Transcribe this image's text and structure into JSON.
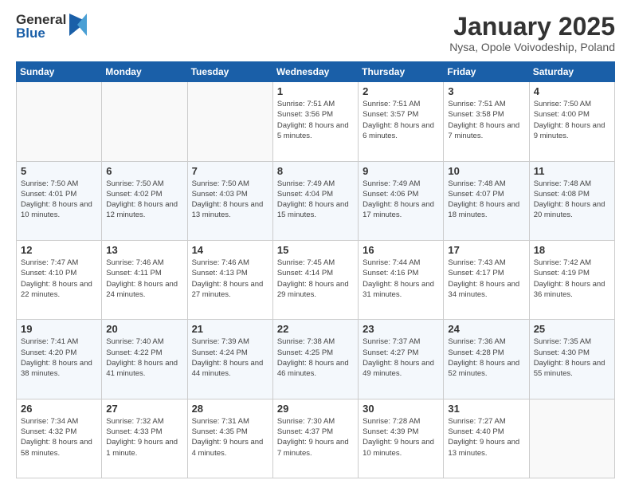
{
  "logo": {
    "general": "General",
    "blue": "Blue"
  },
  "title": "January 2025",
  "subtitle": "Nysa, Opole Voivodeship, Poland",
  "weekdays": [
    "Sunday",
    "Monday",
    "Tuesday",
    "Wednesday",
    "Thursday",
    "Friday",
    "Saturday"
  ],
  "weeks": [
    [
      {
        "day": "",
        "info": ""
      },
      {
        "day": "",
        "info": ""
      },
      {
        "day": "",
        "info": ""
      },
      {
        "day": "1",
        "info": "Sunrise: 7:51 AM\nSunset: 3:56 PM\nDaylight: 8 hours and 5 minutes."
      },
      {
        "day": "2",
        "info": "Sunrise: 7:51 AM\nSunset: 3:57 PM\nDaylight: 8 hours and 6 minutes."
      },
      {
        "day": "3",
        "info": "Sunrise: 7:51 AM\nSunset: 3:58 PM\nDaylight: 8 hours and 7 minutes."
      },
      {
        "day": "4",
        "info": "Sunrise: 7:50 AM\nSunset: 4:00 PM\nDaylight: 8 hours and 9 minutes."
      }
    ],
    [
      {
        "day": "5",
        "info": "Sunrise: 7:50 AM\nSunset: 4:01 PM\nDaylight: 8 hours and 10 minutes."
      },
      {
        "day": "6",
        "info": "Sunrise: 7:50 AM\nSunset: 4:02 PM\nDaylight: 8 hours and 12 minutes."
      },
      {
        "day": "7",
        "info": "Sunrise: 7:50 AM\nSunset: 4:03 PM\nDaylight: 8 hours and 13 minutes."
      },
      {
        "day": "8",
        "info": "Sunrise: 7:49 AM\nSunset: 4:04 PM\nDaylight: 8 hours and 15 minutes."
      },
      {
        "day": "9",
        "info": "Sunrise: 7:49 AM\nSunset: 4:06 PM\nDaylight: 8 hours and 17 minutes."
      },
      {
        "day": "10",
        "info": "Sunrise: 7:48 AM\nSunset: 4:07 PM\nDaylight: 8 hours and 18 minutes."
      },
      {
        "day": "11",
        "info": "Sunrise: 7:48 AM\nSunset: 4:08 PM\nDaylight: 8 hours and 20 minutes."
      }
    ],
    [
      {
        "day": "12",
        "info": "Sunrise: 7:47 AM\nSunset: 4:10 PM\nDaylight: 8 hours and 22 minutes."
      },
      {
        "day": "13",
        "info": "Sunrise: 7:46 AM\nSunset: 4:11 PM\nDaylight: 8 hours and 24 minutes."
      },
      {
        "day": "14",
        "info": "Sunrise: 7:46 AM\nSunset: 4:13 PM\nDaylight: 8 hours and 27 minutes."
      },
      {
        "day": "15",
        "info": "Sunrise: 7:45 AM\nSunset: 4:14 PM\nDaylight: 8 hours and 29 minutes."
      },
      {
        "day": "16",
        "info": "Sunrise: 7:44 AM\nSunset: 4:16 PM\nDaylight: 8 hours and 31 minutes."
      },
      {
        "day": "17",
        "info": "Sunrise: 7:43 AM\nSunset: 4:17 PM\nDaylight: 8 hours and 34 minutes."
      },
      {
        "day": "18",
        "info": "Sunrise: 7:42 AM\nSunset: 4:19 PM\nDaylight: 8 hours and 36 minutes."
      }
    ],
    [
      {
        "day": "19",
        "info": "Sunrise: 7:41 AM\nSunset: 4:20 PM\nDaylight: 8 hours and 38 minutes."
      },
      {
        "day": "20",
        "info": "Sunrise: 7:40 AM\nSunset: 4:22 PM\nDaylight: 8 hours and 41 minutes."
      },
      {
        "day": "21",
        "info": "Sunrise: 7:39 AM\nSunset: 4:24 PM\nDaylight: 8 hours and 44 minutes."
      },
      {
        "day": "22",
        "info": "Sunrise: 7:38 AM\nSunset: 4:25 PM\nDaylight: 8 hours and 46 minutes."
      },
      {
        "day": "23",
        "info": "Sunrise: 7:37 AM\nSunset: 4:27 PM\nDaylight: 8 hours and 49 minutes."
      },
      {
        "day": "24",
        "info": "Sunrise: 7:36 AM\nSunset: 4:28 PM\nDaylight: 8 hours and 52 minutes."
      },
      {
        "day": "25",
        "info": "Sunrise: 7:35 AM\nSunset: 4:30 PM\nDaylight: 8 hours and 55 minutes."
      }
    ],
    [
      {
        "day": "26",
        "info": "Sunrise: 7:34 AM\nSunset: 4:32 PM\nDaylight: 8 hours and 58 minutes."
      },
      {
        "day": "27",
        "info": "Sunrise: 7:32 AM\nSunset: 4:33 PM\nDaylight: 9 hours and 1 minute."
      },
      {
        "day": "28",
        "info": "Sunrise: 7:31 AM\nSunset: 4:35 PM\nDaylight: 9 hours and 4 minutes."
      },
      {
        "day": "29",
        "info": "Sunrise: 7:30 AM\nSunset: 4:37 PM\nDaylight: 9 hours and 7 minutes."
      },
      {
        "day": "30",
        "info": "Sunrise: 7:28 AM\nSunset: 4:39 PM\nDaylight: 9 hours and 10 minutes."
      },
      {
        "day": "31",
        "info": "Sunrise: 7:27 AM\nSunset: 4:40 PM\nDaylight: 9 hours and 13 minutes."
      },
      {
        "day": "",
        "info": ""
      }
    ]
  ]
}
